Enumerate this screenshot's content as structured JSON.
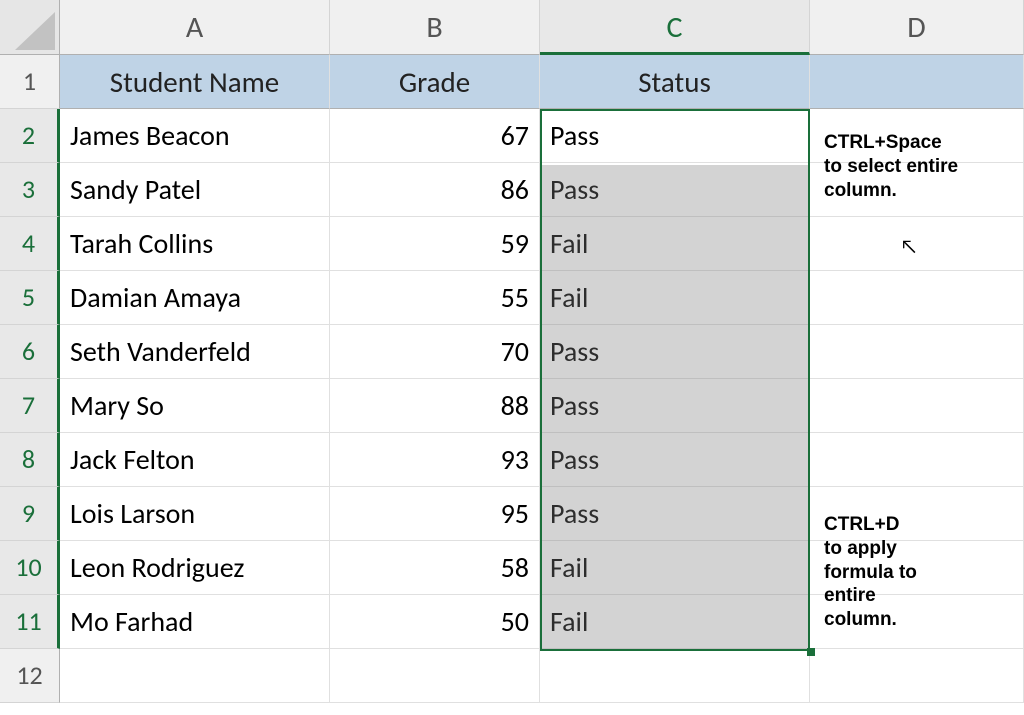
{
  "columns": [
    "A",
    "B",
    "C",
    "D"
  ],
  "colWidths": {
    "A": 270,
    "B": 210,
    "C": 270,
    "D": 214
  },
  "activeColumn": "C",
  "headers": {
    "A": "Student Name",
    "B": "Grade",
    "C": "Status"
  },
  "rows": [
    {
      "n": 1,
      "active": false
    },
    {
      "n": 2,
      "active": true,
      "A": "James Beacon",
      "B": "67",
      "C": "Pass"
    },
    {
      "n": 3,
      "active": true,
      "A": "Sandy Patel",
      "B": "86",
      "C": "Pass"
    },
    {
      "n": 4,
      "active": true,
      "A": "Tarah Collins",
      "B": "59",
      "C": "Fail"
    },
    {
      "n": 5,
      "active": true,
      "A": "Damian Amaya",
      "B": "55",
      "C": "Fail"
    },
    {
      "n": 6,
      "active": true,
      "A": "Seth Vanderfeld",
      "B": "70",
      "C": "Pass"
    },
    {
      "n": 7,
      "active": true,
      "A": "Mary So",
      "B": "88",
      "C": "Pass"
    },
    {
      "n": 8,
      "active": true,
      "A": "Jack Felton",
      "B": "93",
      "C": "Pass"
    },
    {
      "n": 9,
      "active": true,
      "A": "Lois Larson",
      "B": "95",
      "C": "Pass"
    },
    {
      "n": 10,
      "active": true,
      "A": "Leon Rodriguez",
      "B": "58",
      "C": "Fail"
    },
    {
      "n": 11,
      "active": true,
      "A": "Mo Farhad",
      "B": "50",
      "C": "Fail"
    },
    {
      "n": 12,
      "active": false
    }
  ],
  "notes": {
    "top": "CTRL+Space\nto select entire\ncolumn.",
    "bottom": "CTRL+D\nto apply\nformula to\nentire\ncolumn."
  },
  "chart_data": {
    "type": "table",
    "columns": [
      "Student Name",
      "Grade",
      "Status"
    ],
    "data": [
      [
        "James Beacon",
        67,
        "Pass"
      ],
      [
        "Sandy Patel",
        86,
        "Pass"
      ],
      [
        "Tarah Collins",
        59,
        "Fail"
      ],
      [
        "Damian Amaya",
        55,
        "Fail"
      ],
      [
        "Seth Vanderfeld",
        70,
        "Pass"
      ],
      [
        "Mary So",
        88,
        "Pass"
      ],
      [
        "Jack Felton",
        93,
        "Pass"
      ],
      [
        "Lois Larson",
        95,
        "Pass"
      ],
      [
        "Leon Rodriguez",
        58,
        "Fail"
      ],
      [
        "Mo Farhad",
        50,
        "Fail"
      ]
    ]
  }
}
